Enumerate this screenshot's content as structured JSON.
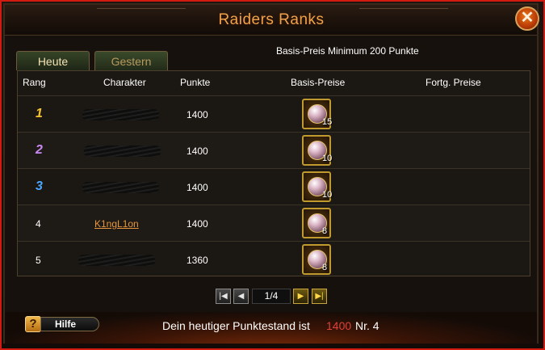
{
  "window": {
    "title": "Raiders Ranks",
    "close_label": "✕"
  },
  "tabs": [
    {
      "label": "Heute",
      "active": true
    },
    {
      "label": "Gestern",
      "active": false
    }
  ],
  "minimum": {
    "label": "Basis-Preis Minimum",
    "value": "200 Punkte"
  },
  "table": {
    "headers": [
      "Rang",
      "Charakter",
      "Punkte",
      "Basis-Preise",
      "Fortg. Preise"
    ],
    "rows": [
      {
        "rank": "1",
        "character": "",
        "points": "1400",
        "reward_count": "15"
      },
      {
        "rank": "2",
        "character": "",
        "points": "1400",
        "reward_count": "10"
      },
      {
        "rank": "3",
        "character": "",
        "points": "1400",
        "reward_count": "10"
      },
      {
        "rank": "4",
        "character": "K1ngL1on",
        "points": "1400",
        "reward_count": "8"
      },
      {
        "rank": "5",
        "character": "",
        "points": "1360",
        "reward_count": "8"
      }
    ]
  },
  "pagination": {
    "page": "1/4",
    "first_icon": "first-page-icon",
    "prev_icon": "prev-page-icon",
    "next_icon": "next-page-icon",
    "last_icon": "last-page-icon"
  },
  "footer": {
    "help_label": "Hilfe",
    "help_icon": "?",
    "status_prefix": "Dein heutiger Punktestand ist",
    "score": "1400",
    "rank_text": "Nr. 4"
  },
  "colors": {
    "rank1": "#f5c430",
    "rank2": "#c888f0",
    "rank3": "#4aa6ff",
    "accent": "#f0a24a",
    "score": "#e0403a"
  }
}
